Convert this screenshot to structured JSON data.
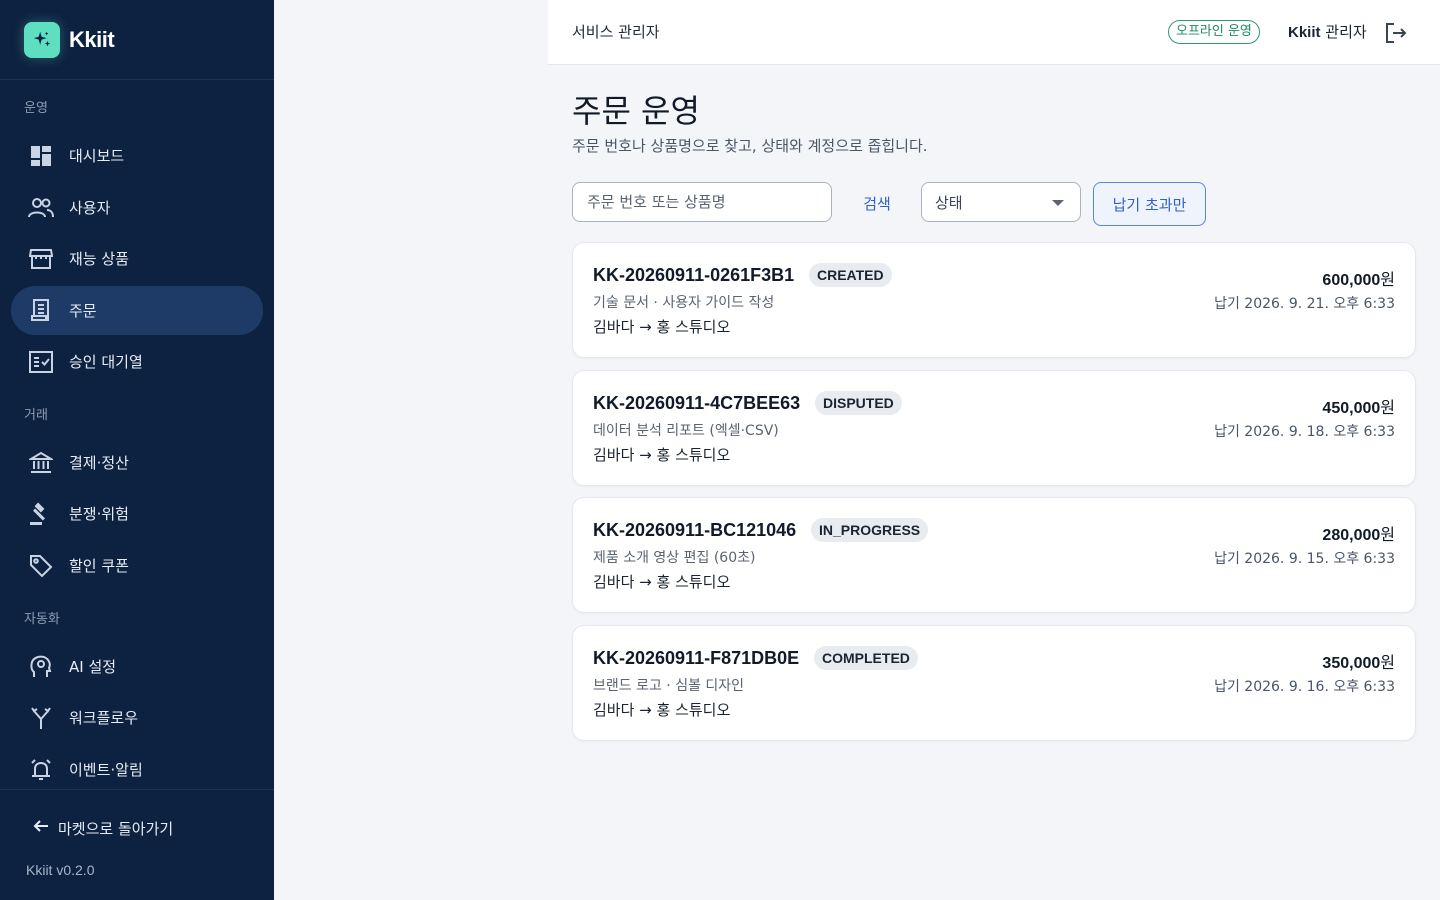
{
  "brand": {
    "name": "Kkiit",
    "logo_icon": "sparkle-icon",
    "logo_color": "#5ee0c0"
  },
  "sidebar": {
    "sections": [
      {
        "label": "운영",
        "items": [
          {
            "label": "대시보드",
            "icon": "dashboard-icon"
          },
          {
            "label": "사용자",
            "icon": "users-icon"
          },
          {
            "label": "재능 상품",
            "icon": "store-icon"
          },
          {
            "label": "주문",
            "icon": "receipt-icon",
            "active": true
          },
          {
            "label": "승인 대기열",
            "icon": "checklist-icon"
          }
        ]
      },
      {
        "label": "거래",
        "items": [
          {
            "label": "결제·정산",
            "icon": "bank-icon"
          },
          {
            "label": "분쟁·위험",
            "icon": "gavel-icon"
          },
          {
            "label": "할인 쿠폰",
            "icon": "tag-icon"
          }
        ]
      },
      {
        "label": "자동화",
        "items": [
          {
            "label": "AI 설정",
            "icon": "ai-brain-icon"
          },
          {
            "label": "워크플로우",
            "icon": "workflow-icon"
          },
          {
            "label": "이벤트·알림",
            "icon": "alarm-bell-icon"
          }
        ]
      }
    ],
    "back_label": "마켓으로 돌아가기",
    "version": "Kkiit v0.2.0"
  },
  "topbar": {
    "title": "서비스 관리자",
    "badge": "오프라인 운영",
    "admin_brand": "Kkiit",
    "admin_role": "관리자"
  },
  "main": {
    "title": "주문 운영",
    "subtitle": "주문 번호나 상품명으로 찾고, 상태와 계정으로 좁힙니다.",
    "search_placeholder": "주문 번호 또는 상품명",
    "search_button": "검색",
    "status_select": "상태",
    "overdue_button": "납기 초과만"
  },
  "orders": [
    {
      "id": "KK-20260911-0261F3B1",
      "status": "CREATED",
      "title": "기술 문서 · 사용자 가이드 작성",
      "parties": "김바다 → 홍 스튜디오",
      "amount": "600,000",
      "currency": "원",
      "due": "납기 2026. 9. 21. 오후 6:33"
    },
    {
      "id": "KK-20260911-4C7BEE63",
      "status": "DISPUTED",
      "title": "데이터 분석 리포트 (엑셀·CSV)",
      "parties": "김바다 → 홍 스튜디오",
      "amount": "450,000",
      "currency": "원",
      "due": "납기 2026. 9. 18. 오후 6:33"
    },
    {
      "id": "KK-20260911-BC121046",
      "status": "IN_PROGRESS",
      "title": "제품 소개 영상 편집 (60초)",
      "parties": "김바다 → 홍 스튜디오",
      "amount": "280,000",
      "currency": "원",
      "due": "납기 2026. 9. 15. 오후 6:33"
    },
    {
      "id": "KK-20260911-F871DB0E",
      "status": "COMPLETED",
      "title": "브랜드 로고 · 심볼 디자인",
      "parties": "김바다 → 홍 스튜디오",
      "amount": "350,000",
      "currency": "원",
      "due": "납기 2026. 9. 16. 오후 6:33"
    }
  ],
  "colors": {
    "sidebar_bg": "#0d2140",
    "active_item": "#1e3a66",
    "accent": "#2f62c4",
    "offline_badge": "#1f8a5c"
  }
}
